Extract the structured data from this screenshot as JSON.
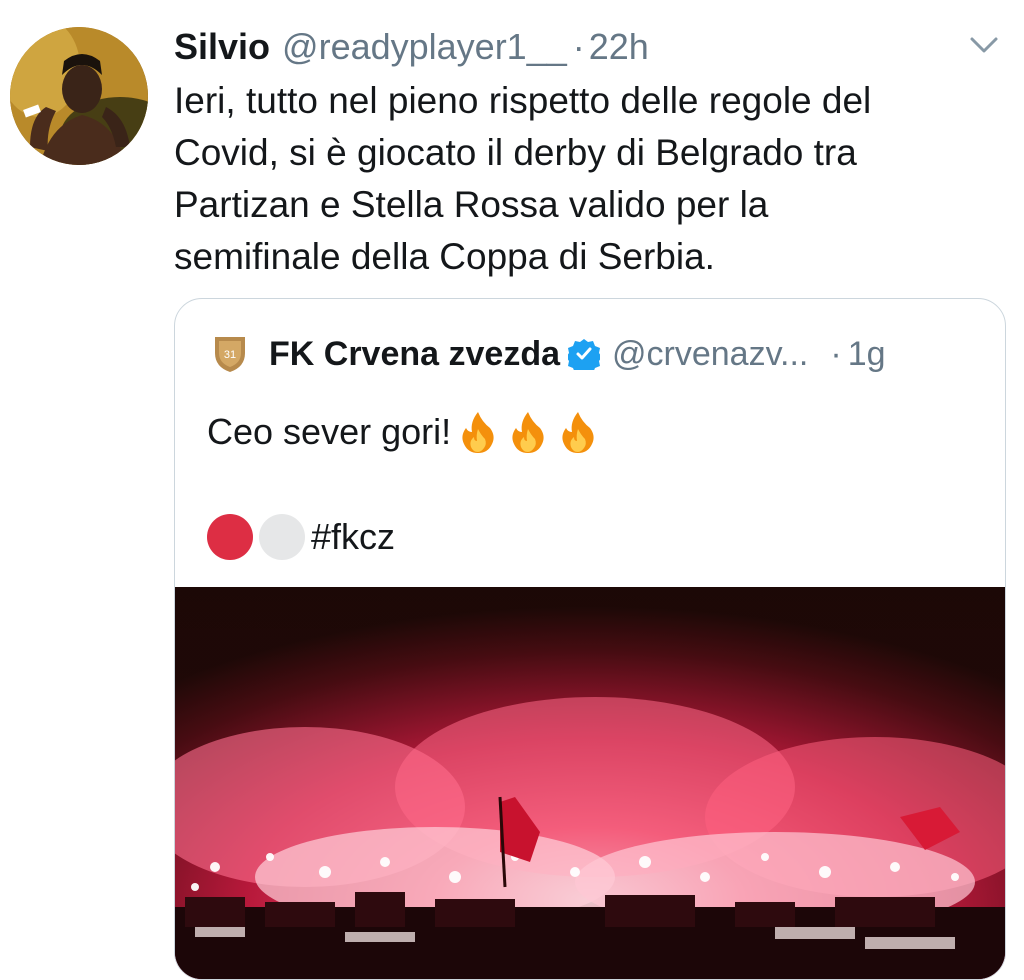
{
  "tweet": {
    "author_name": "Silvio",
    "author_handle": "@readyplayer1__",
    "separator": "·",
    "time": "22h",
    "avatar_icon": "user-avatar",
    "menu_icon": "chevron-down-icon",
    "text_lines": [
      "Ieri, tutto nel pieno rispetto delle regole del",
      "Covid, si è giocato il derby di Belgrado tra",
      "Partizan e Stella Rossa valido per la",
      "semifinale della Coppa di Serbia."
    ]
  },
  "quoted_tweet": {
    "crest_icon": "club-crest-icon",
    "author_name": "FK Crvena zvezda",
    "verified_icon": "verified-badge-icon",
    "author_handle": "@crvenazv...",
    "separator": "·",
    "time": "1g",
    "text": "Ceo sever gori!",
    "emoji": [
      "fire-icon",
      "fire-icon",
      "fire-icon"
    ],
    "circles": [
      "red-circle-icon",
      "white-circle-icon"
    ],
    "hashtag": "#fkcz",
    "media": "stadium-flares-photo"
  },
  "colors": {
    "text_primary": "#14171a",
    "text_secondary": "#657786",
    "border": "#ccd6dd",
    "verified_blue": "#1da1f2",
    "red_circle": "#dd2e44",
    "white_circle": "#e6e7e8"
  }
}
